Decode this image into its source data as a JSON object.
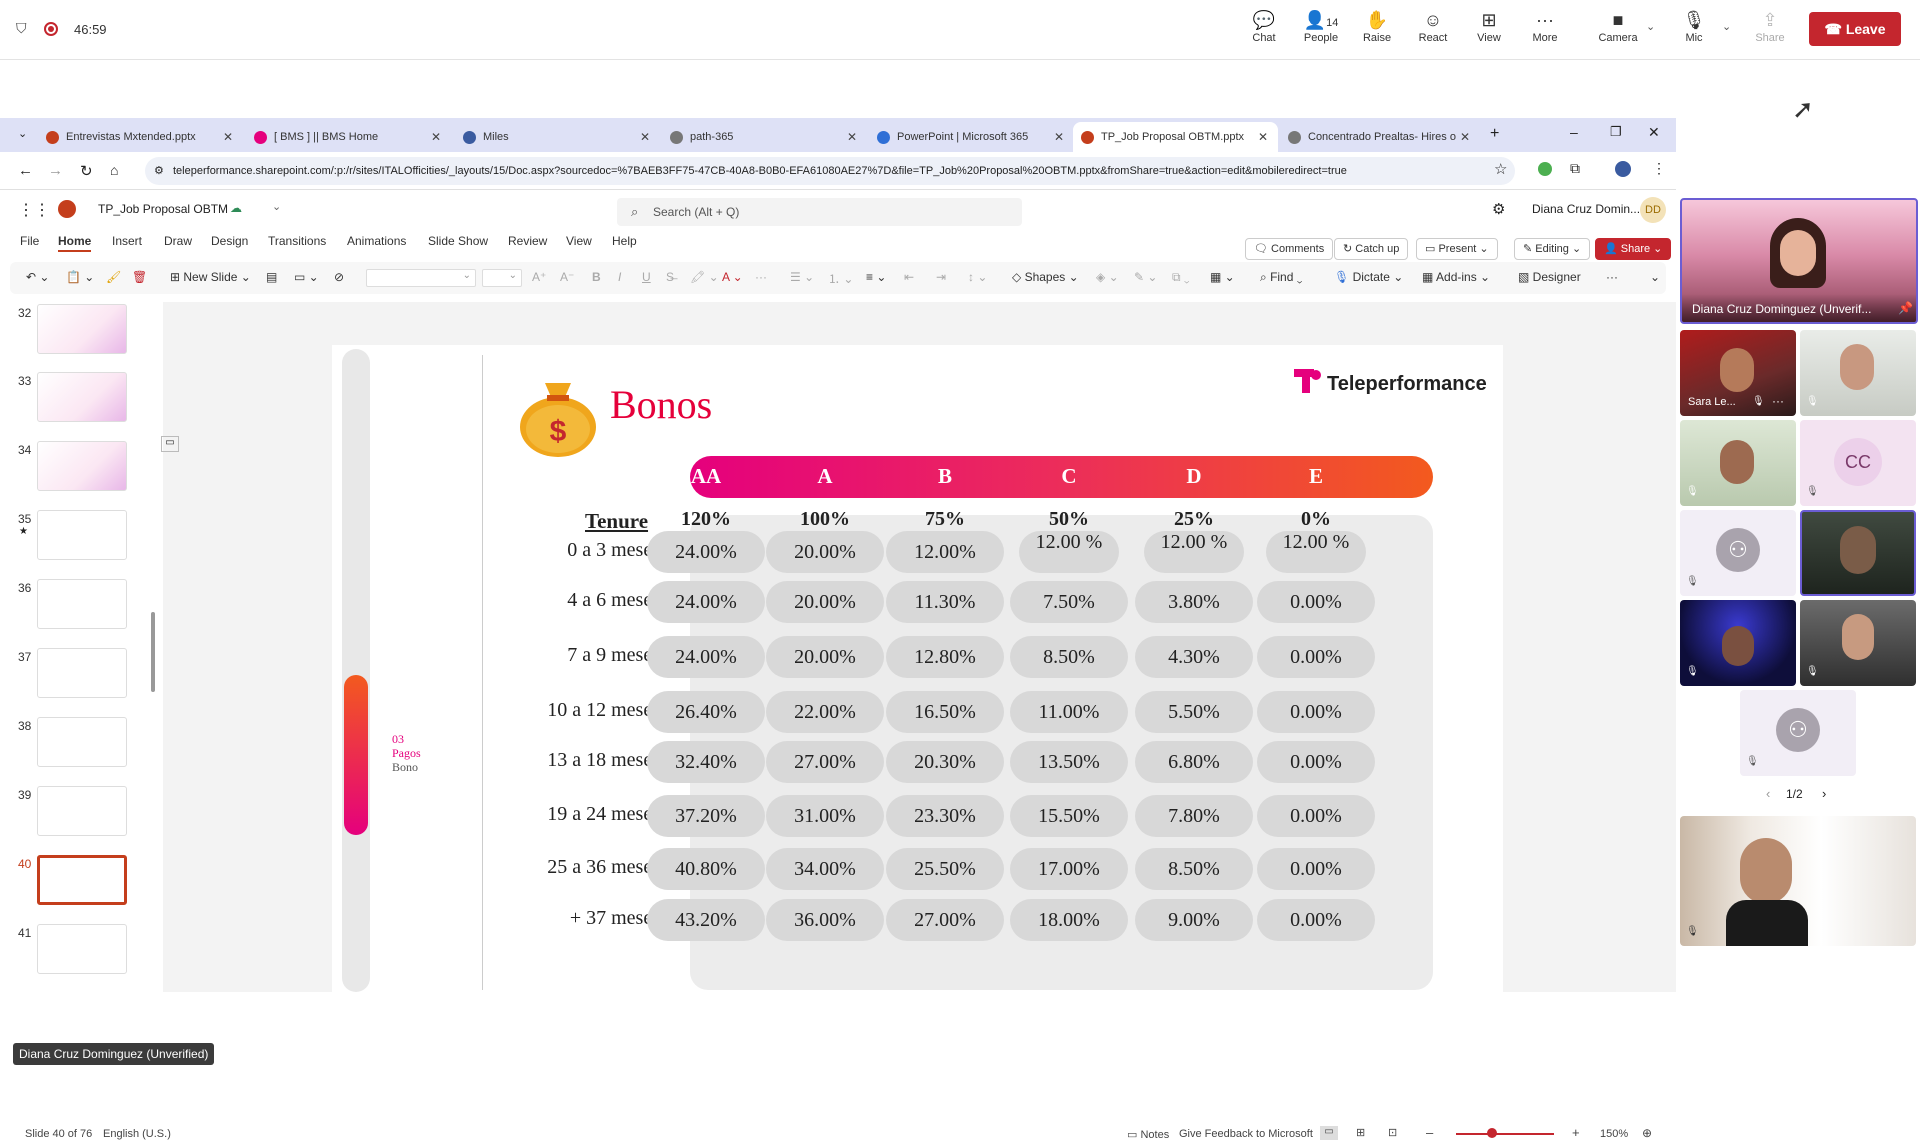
{
  "teams": {
    "timer": "46:59",
    "buttons": [
      {
        "label": "Chat",
        "icon": "chat-icon"
      },
      {
        "label": "People",
        "icon": "people-icon",
        "count": "14"
      },
      {
        "label": "Raise",
        "icon": "raise-hand-icon"
      },
      {
        "label": "React",
        "icon": "react-icon"
      },
      {
        "label": "View",
        "icon": "view-icon"
      },
      {
        "label": "More",
        "icon": "more-icon"
      },
      {
        "label": "Camera",
        "icon": "camera-icon"
      },
      {
        "label": "Mic",
        "icon": "mic-off-icon"
      },
      {
        "label": "Share",
        "icon": "share-icon"
      }
    ],
    "leave_label": "Leave",
    "presenter_badge": "Diana Cruz Dominguez (Unverified)"
  },
  "browser": {
    "tabs": [
      {
        "label": "Entrevistas Mxtended.pptx"
      },
      {
        "label": "[ BMS ] || BMS Home"
      },
      {
        "label": "Miles"
      },
      {
        "label": "path-365"
      },
      {
        "label": "PowerPoint | Microsoft 365"
      },
      {
        "label": "TP_Job Proposal OBTM.pptx"
      },
      {
        "label": "Concentrado Prealtas- Hires o"
      }
    ],
    "url": "teleperformance.sharepoint.com/:p:/r/sites/ITALOfficities/_layouts/15/Doc.aspx?sourcedoc=%7BAEB3FF75-47CB-40A8-B0B0-EFA61080AE27%7D&file=TP_Job%20Proposal%20OBTM.pptx&fromShare=true&action=edit&mobileredirect=true"
  },
  "ppt": {
    "file_name": "TP_Job Proposal OBTM",
    "search_placeholder": "Search (Alt + Q)",
    "user_name": "Diana Cruz Domin...",
    "user_initials": "DD",
    "menus": [
      "File",
      "Home",
      "Insert",
      "Draw",
      "Design",
      "Transitions",
      "Animations",
      "Slide Show",
      "Review",
      "View",
      "Help"
    ],
    "actions": {
      "comments": "Comments",
      "catch_up": "Catch up",
      "present": "Present",
      "editing": "Editing",
      "share": "Share"
    },
    "ribbon": {
      "new_slide": "New Slide",
      "shapes": "Shapes",
      "find": "Find",
      "dictate": "Dictate",
      "addins": "Add-ins",
      "designer": "Designer"
    },
    "thumbnails": [
      "32",
      "33",
      "34",
      "35",
      "36",
      "37",
      "38",
      "39",
      "40",
      "41"
    ],
    "status": {
      "slide_info": "Slide 40 of 76",
      "language": "English (U.S.)",
      "notes": "Notes",
      "feedback": "Give Feedback to Microsoft",
      "zoom": "150%"
    }
  },
  "slide": {
    "title": "Bonos",
    "logo_text": "Teleperformance",
    "side_nav": {
      "number": "03",
      "line1": "Pagos",
      "line2": "Bono"
    },
    "tenure_header": "Tenure",
    "grades": [
      "AA",
      "A",
      "B",
      "C",
      "D",
      "E"
    ],
    "grade_pcts": [
      "120%",
      "100%",
      "75%",
      "50%",
      "25%",
      "0%"
    ],
    "rows": [
      {
        "label": "0 a 3 meses",
        "values": [
          "24.00%",
          "20.00%",
          "12.00%",
          "12.00 %",
          "12.00 %",
          "12.00 %"
        ]
      },
      {
        "label": "4 a 6 meses",
        "values": [
          "24.00%",
          "20.00%",
          "11.30%",
          "7.50%",
          "3.80%",
          "0.00%"
        ]
      },
      {
        "label": "7 a 9 meses",
        "values": [
          "24.00%",
          "20.00%",
          "12.80%",
          "8.50%",
          "4.30%",
          "0.00%"
        ]
      },
      {
        "label": "10 a 12 meses",
        "values": [
          "26.40%",
          "22.00%",
          "16.50%",
          "11.00%",
          "5.50%",
          "0.00%"
        ]
      },
      {
        "label": "13 a 18 meses",
        "values": [
          "32.40%",
          "27.00%",
          "20.30%",
          "13.50%",
          "6.80%",
          "0.00%"
        ]
      },
      {
        "label": "19 a 24 meses",
        "values": [
          "37.20%",
          "31.00%",
          "23.30%",
          "15.50%",
          "7.80%",
          "0.00%"
        ]
      },
      {
        "label": "25 a 36 meses",
        "values": [
          "40.80%",
          "34.00%",
          "25.50%",
          "17.00%",
          "8.50%",
          "0.00%"
        ]
      },
      {
        "label": "+ 37 meses",
        "values": [
          "43.20%",
          "36.00%",
          "27.00%",
          "18.00%",
          "9.00%",
          "0.00%"
        ]
      }
    ]
  },
  "participants": {
    "main_name": "Diana Cruz Dominguez (Unverif...",
    "tile_name": "Sara Le...",
    "initials": "CC",
    "page": "1/2"
  },
  "colors": {
    "accent": "#c43e1c",
    "leave": "#c4262e",
    "brand": "#e5007d",
    "gradient_end": "#f35a1e"
  }
}
